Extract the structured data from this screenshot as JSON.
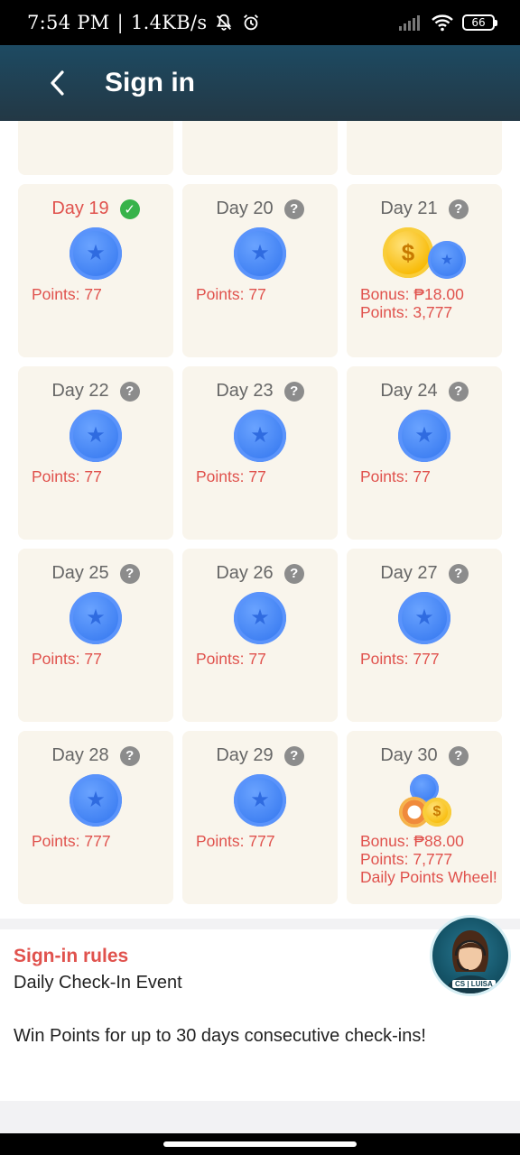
{
  "status_bar": {
    "time": "7:54 PM",
    "separator": "|",
    "speed": "1.4KB/s",
    "battery": "66"
  },
  "header": {
    "title": "Sign in"
  },
  "days": [
    {
      "label": "Day 19",
      "status": "checked",
      "lines": [
        "Points: 77"
      ]
    },
    {
      "label": "Day 20",
      "status": "unknown",
      "lines": [
        "Points: 77"
      ]
    },
    {
      "label": "Day 21",
      "status": "unknown",
      "lines": [
        "Bonus: ₱18.00",
        "Points: 3,777"
      ]
    },
    {
      "label": "Day 22",
      "status": "unknown",
      "lines": [
        "Points: 77"
      ]
    },
    {
      "label": "Day 23",
      "status": "unknown",
      "lines": [
        "Points: 77"
      ]
    },
    {
      "label": "Day 24",
      "status": "unknown",
      "lines": [
        "Points: 77"
      ]
    },
    {
      "label": "Day 25",
      "status": "unknown",
      "lines": [
        "Points: 77"
      ]
    },
    {
      "label": "Day 26",
      "status": "unknown",
      "lines": [
        "Points: 77"
      ]
    },
    {
      "label": "Day 27",
      "status": "unknown",
      "lines": [
        "Points: 777"
      ]
    },
    {
      "label": "Day 28",
      "status": "unknown",
      "lines": [
        "Points: 777"
      ]
    },
    {
      "label": "Day 29",
      "status": "unknown",
      "lines": [
        "Points: 777"
      ]
    },
    {
      "label": "Day 30",
      "status": "unknown",
      "lines": [
        "Bonus: ₱88.00",
        "Points: 7,777",
        "Daily Points Wheel!"
      ]
    }
  ],
  "rules": {
    "title": "Sign-in rules",
    "subtitle": "Daily Check-In Event",
    "text": "Win Points for up to 30 days consecutive check-ins!"
  },
  "avatar": {
    "label": "CS | LUISA"
  },
  "colors": {
    "accent_red": "#e0524d",
    "header_dark": "#233845",
    "card_bg": "#f9f5ec",
    "check_green": "#37b34a"
  }
}
